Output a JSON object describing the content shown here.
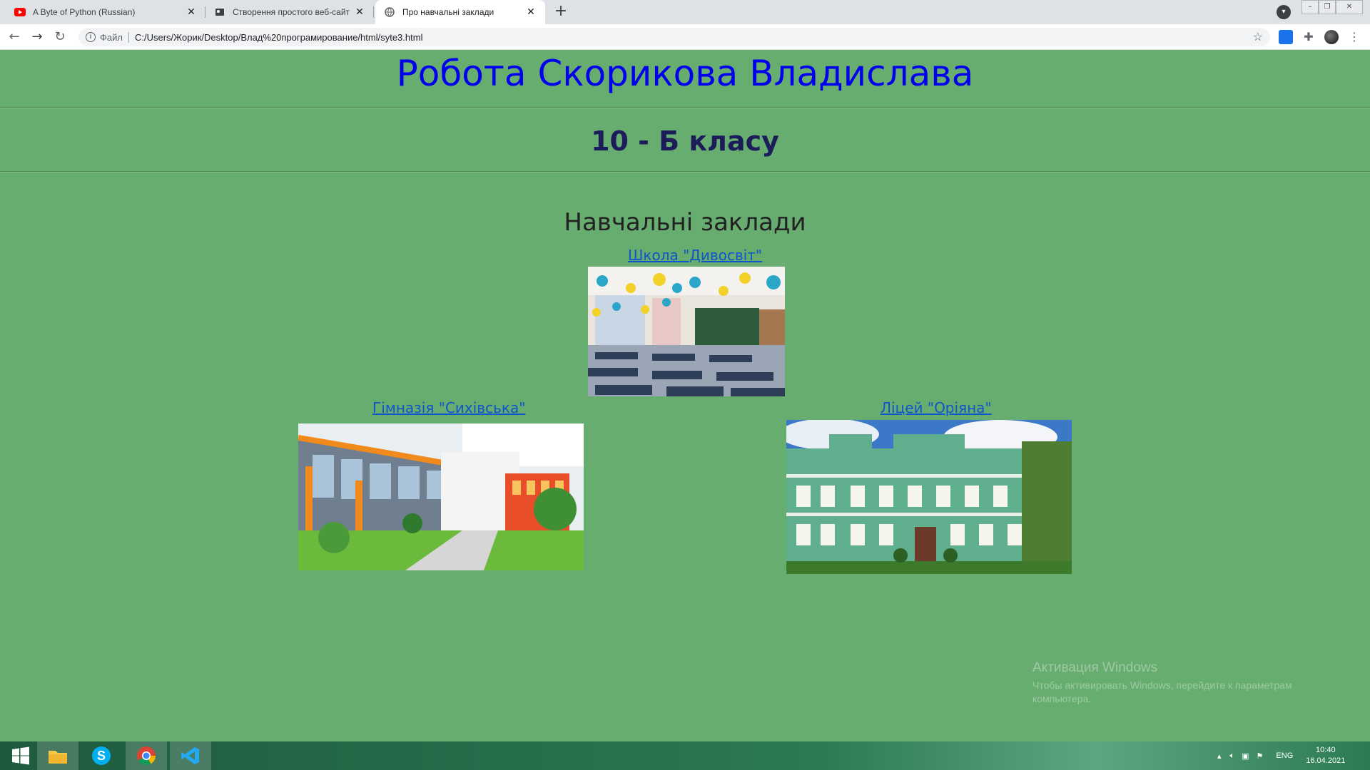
{
  "browser": {
    "tabs": [
      {
        "title": "A Byte of Python (Russian)",
        "favicon": "youtube-icon"
      },
      {
        "title": "Створення простого веб-сайту",
        "favicon": "globe-icon"
      },
      {
        "title": "Про навчальні заклади",
        "favicon": "globe-icon"
      }
    ],
    "address": {
      "scheme_label": "Файл",
      "url": "C:/Users/Жорик/Desktop/Влад%20програмирование/html/syte3.html"
    }
  },
  "page": {
    "title": "Робота Скорикова Владислава",
    "class_heading": "10 - Б класу",
    "section_heading": "Навчальні заклади",
    "institutions": [
      {
        "name": "Школа \"Дивосвіт\"",
        "image": "classroom-photo"
      },
      {
        "name": "Гімназія \"Сихівська\"",
        "image": "modern-school-building-photo"
      },
      {
        "name": "Ліцей \"Оріяна\"",
        "image": "green-historic-building-photo"
      }
    ],
    "colors": {
      "background": "#67ad70",
      "title": "#0000ee",
      "heading": "#1c1c5a"
    }
  },
  "windows_activation": {
    "title": "Активация Windows",
    "message": "Чтобы активировать Windows, перейдите к параметрам компьютера."
  },
  "taskbar": {
    "language": "ENG",
    "time": "10:40",
    "date": "16.04.2021"
  }
}
